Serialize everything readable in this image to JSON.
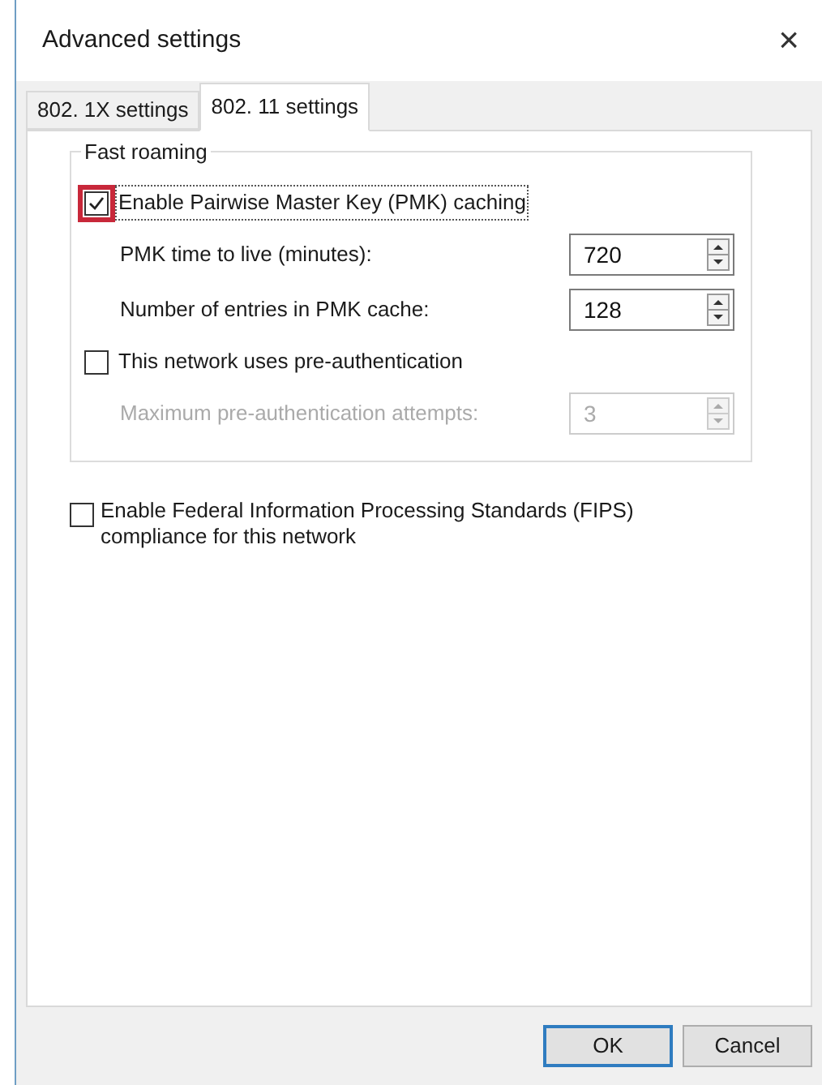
{
  "window": {
    "title": "Advanced settings",
    "close": "×"
  },
  "tabs": [
    {
      "label": "802. 1X settings",
      "selected": false
    },
    {
      "label": "802. 11 settings",
      "selected": true
    }
  ],
  "group": {
    "title": "Fast roaming",
    "rows": [
      {
        "kind": "checkbox",
        "label": "Enable Pairwise Master Key (PMK) caching",
        "checked": true,
        "highlighted": true,
        "focused": true,
        "disabled": false
      },
      {
        "kind": "spinner",
        "label": "PMK time to live (minutes):",
        "value": "720",
        "disabled": false
      },
      {
        "kind": "spinner",
        "label": "Number of entries in PMK cache:",
        "value": "128",
        "disabled": false
      },
      {
        "kind": "checkbox",
        "label": "This network uses pre-authentication",
        "checked": false,
        "highlighted": false,
        "focused": false,
        "disabled": false
      },
      {
        "kind": "spinner",
        "label": "Maximum pre-authentication attempts:",
        "value": "3",
        "disabled": true
      }
    ]
  },
  "fips": {
    "label": "Enable Federal Information Processing Standards (FIPS) compliance for this network",
    "checked": false
  },
  "buttons": [
    {
      "label": "OK",
      "default": true
    },
    {
      "label": "Cancel",
      "default": false
    }
  ]
}
